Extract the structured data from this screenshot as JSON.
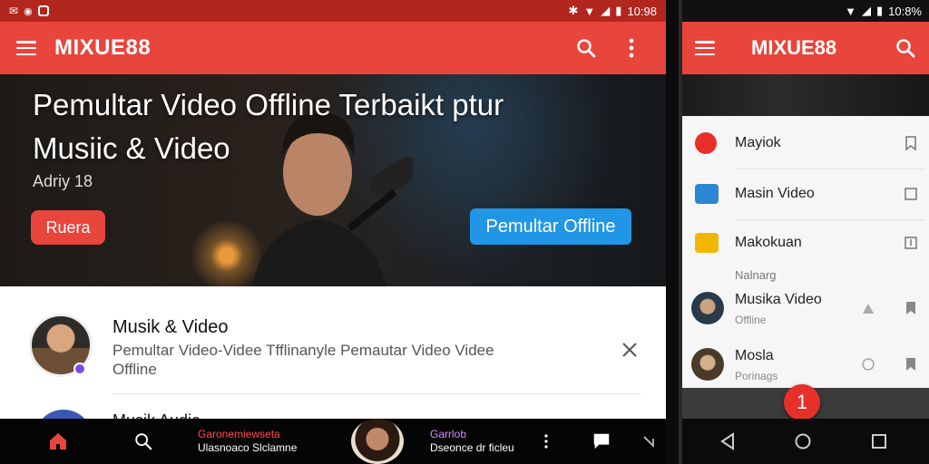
{
  "left": {
    "status": {
      "time": "10:98"
    },
    "topbar": {
      "title": "MIXUE88"
    },
    "hero": {
      "title_line1": "Pemultar Video Offline Terbaikt ptur",
      "title_line2": "Musiic & Video",
      "subtitle": "Adriy 18",
      "left_button": "Ruera",
      "right_button": "Pemultar Offline"
    },
    "card": {
      "title": "Musik & Video",
      "description": "Pemultar Video-Videe Tfflinanyle Pemautar Video Videe Offline",
      "next_title": "Musik Audio"
    },
    "mini_player": {
      "left_line1": "Garonemiewseta",
      "left_line2": "Ulasnoaco Slclamne",
      "right_line1": "Garrlob",
      "right_line2": "Dseonce dr ficleu"
    }
  },
  "right": {
    "status": {
      "time": "10:8%"
    },
    "topbar": {
      "title": "MIXUE88"
    },
    "menu": [
      {
        "label": "Mayiok",
        "icon": "music-icon"
      },
      {
        "label": "Masin Video",
        "icon": "video-icon"
      },
      {
        "label": "Makokuan",
        "icon": "folder-icon"
      }
    ],
    "section_label": "Nalnarg",
    "items": [
      {
        "title": "Musika Video",
        "sub": "Offline"
      },
      {
        "title": "Mosla",
        "sub": "Porinags"
      }
    ],
    "fab_label": "1"
  },
  "colors": {
    "accent": "#e8453c",
    "blue": "#2196e6",
    "dark": "#050505"
  }
}
